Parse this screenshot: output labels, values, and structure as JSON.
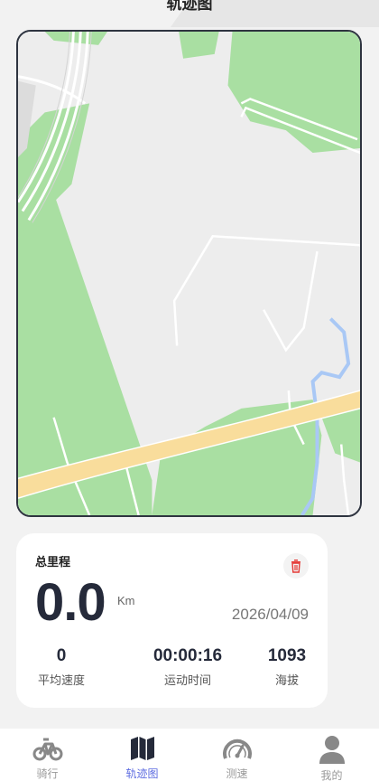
{
  "header": {
    "title": "轨迹图"
  },
  "stats": {
    "title": "总里程",
    "distance": "0.0",
    "unit": "Km",
    "date": "2026/04/09",
    "avg_speed": {
      "value": "0",
      "label": "平均速度"
    },
    "duration": {
      "value": "00:00:16",
      "label": "运动时间"
    },
    "altitude": {
      "value": "1093",
      "label": "海拔"
    },
    "delete_icon": "trash-icon"
  },
  "tabs": [
    {
      "label": "骑行",
      "icon": "bicycle-icon",
      "active": false
    },
    {
      "label": "轨迹图",
      "icon": "map-icon",
      "active": true
    },
    {
      "label": "测速",
      "icon": "speedometer-icon",
      "active": false
    },
    {
      "label": "我的",
      "icon": "user-icon",
      "active": false
    }
  ],
  "colors": {
    "accent": "#5b6ae0",
    "delete": "#e53935",
    "map_green": "#a9dfa2",
    "map_road": "#f9dd9c",
    "map_water": "#a9c8f5"
  }
}
